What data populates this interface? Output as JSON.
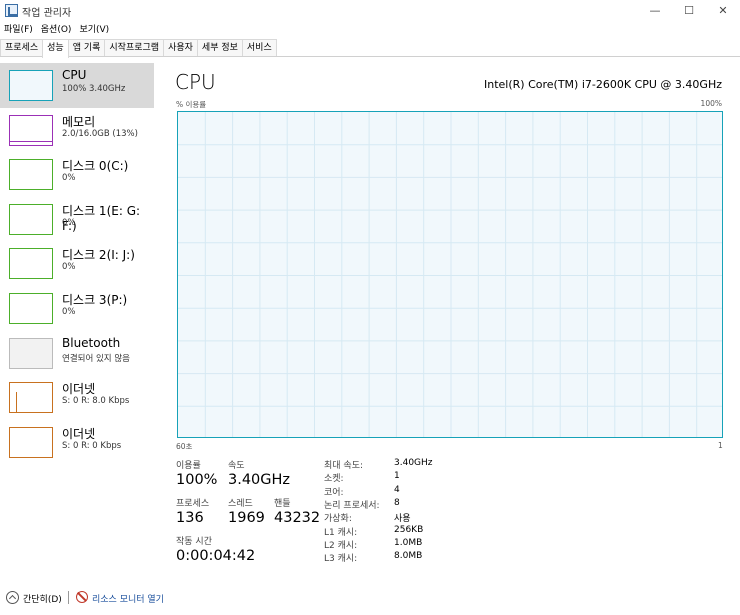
{
  "window": {
    "title": "작업 관리자",
    "minimize": "—",
    "maximize": "☐",
    "close": "✕"
  },
  "menu": [
    "파일(F)",
    "옵션(O)",
    "보기(V)"
  ],
  "tabs": [
    "프로세스",
    "성능",
    "앱 기록",
    "시작프로그램",
    "사용자",
    "세부 정보",
    "서비스"
  ],
  "active_tab": "성능",
  "sidebar": [
    {
      "name": "CPU",
      "sub": "100% 3.40GHz",
      "color": "#17a2b8"
    },
    {
      "name": "메모리",
      "sub": "2.0/16.0GB (13%)",
      "color": "#9b30b6"
    },
    {
      "name": "디스크 0(C:)",
      "sub": "0%",
      "color": "#4caf2a"
    },
    {
      "name": "디스크 1(E: G: F:)",
      "sub": "0%",
      "color": "#4caf2a"
    },
    {
      "name": "디스크 2(I: J:)",
      "sub": "0%",
      "color": "#4caf2a"
    },
    {
      "name": "디스크 3(P:)",
      "sub": "0%",
      "color": "#4caf2a"
    },
    {
      "name": "Bluetooth",
      "sub": "연결되어 있지 않음",
      "color": "#bbbbbb"
    },
    {
      "name": "이더넷",
      "sub": "S: 0  R: 8.0 Kbps",
      "color": "#c8711f"
    },
    {
      "name": "이더넷",
      "sub": "S: 0  R: 0 Kbps",
      "color": "#c8711f"
    }
  ],
  "main": {
    "title": "CPU",
    "model": "Intel(R) Core(TM) i7-2600K CPU @ 3.40GHz",
    "y_axis_label": "% 이용률",
    "y_axis_max": "100%",
    "x_axis_left": "60초",
    "x_axis_right": "1"
  },
  "stats": {
    "utilization_label": "이용률",
    "utilization": "100%",
    "speed_label": "속도",
    "speed": "3.40GHz",
    "processes_label": "프로세스",
    "processes": "136",
    "threads_label": "스레드",
    "threads": "1969",
    "handles_label": "핸들",
    "handles": "43232",
    "uptime_label": "작동 시간",
    "uptime": "0:00:04:42"
  },
  "specs": [
    {
      "label": "최대 속도:",
      "value": "3.40GHz"
    },
    {
      "label": "소켓:",
      "value": "1"
    },
    {
      "label": "코어:",
      "value": "4"
    },
    {
      "label": "논리 프로세서:",
      "value": "8"
    },
    {
      "label": "가상화:",
      "value": "사용"
    },
    {
      "label": "L1 캐시:",
      "value": "256KB"
    },
    {
      "label": "L2 캐시:",
      "value": "1.0MB"
    },
    {
      "label": "L3 캐시:",
      "value": "8.0MB"
    }
  ],
  "bottom": {
    "fewer_details": "간단히(D)",
    "resource_monitor": "리소스 모니터 열기"
  }
}
